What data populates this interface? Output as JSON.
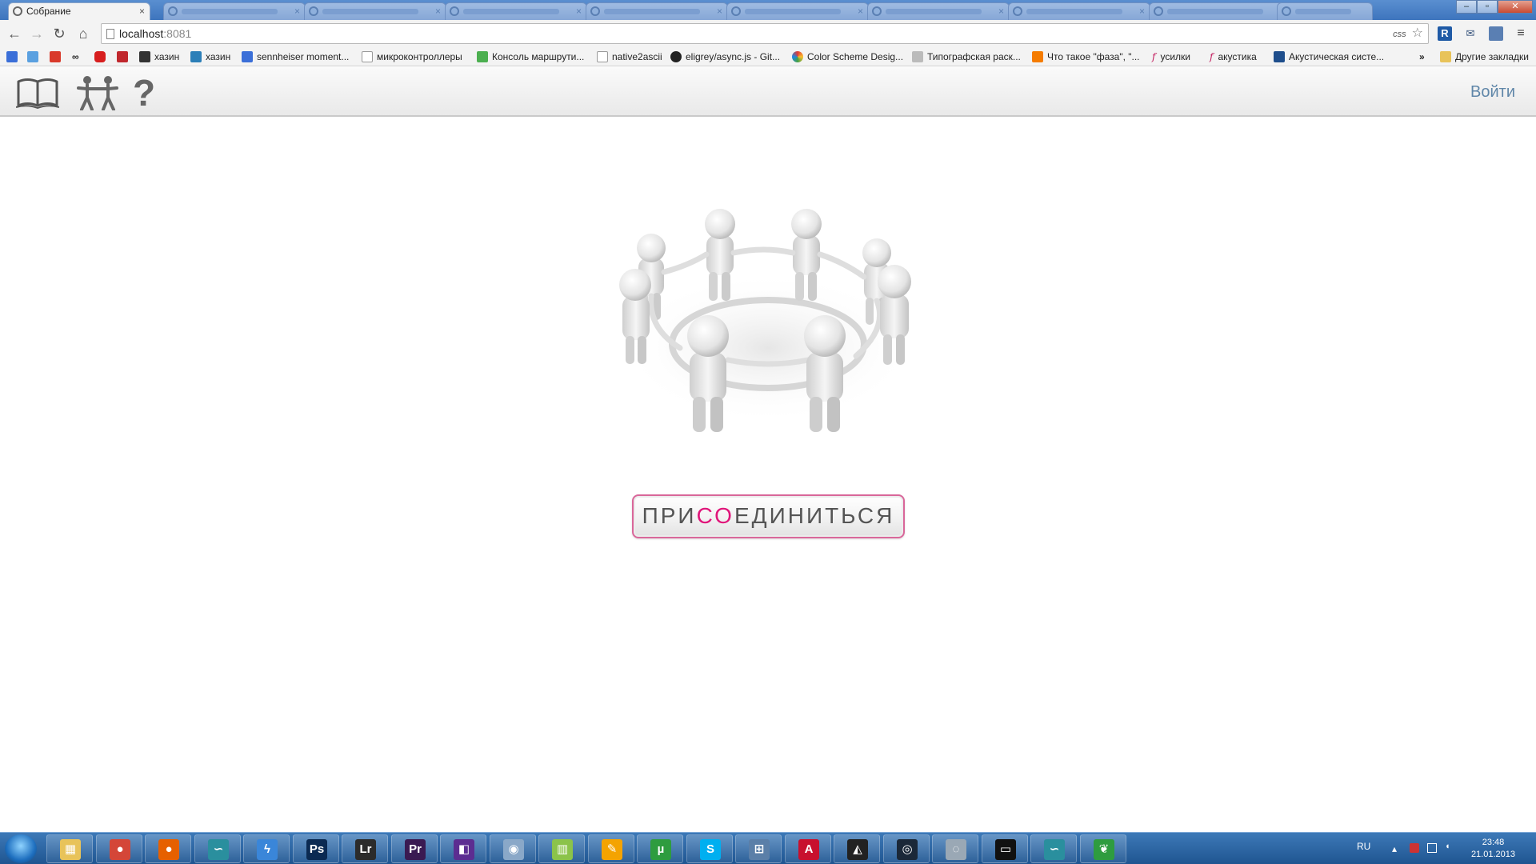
{
  "browser": {
    "active_tab_title": "Собрание",
    "tab_close": "×",
    "url_host": "localhost",
    "url_port": ":8081",
    "omnibox_badge": "css",
    "window_buttons": {
      "minimize": "–",
      "maximize": "▫",
      "close": "✕"
    },
    "nav": {
      "back": "←",
      "forward": "→",
      "reload": "↻",
      "home": "⌂"
    },
    "bookmarks": [
      {
        "label": "",
        "icon": "google-plus-icon",
        "color": "#3b6fd8"
      },
      {
        "label": "",
        "icon": "h-icon",
        "color": "#5aa0e0"
      },
      {
        "label": "",
        "icon": "pp-icon",
        "color": "#d93a2b"
      },
      {
        "label": "",
        "icon": "infinity-icon",
        "color": "#222222"
      },
      {
        "label": "",
        "icon": "youtube-icon",
        "color": "#d71e1e"
      },
      {
        "label": "",
        "icon": "red-book-icon",
        "color": "#c0272d"
      },
      {
        "label": "хазин",
        "icon": "rss-icon",
        "color": "#333333"
      },
      {
        "label": "хазин",
        "icon": "chart-icon",
        "color": "#2c7fb8"
      },
      {
        "label": "sennheiser moment...",
        "icon": "google-icon",
        "color": "#3b6fd8"
      },
      {
        "label": "микроконтроллеры",
        "icon": "page-icon",
        "color": "#ffffff"
      },
      {
        "label": "Консоль маршрути...",
        "icon": "grid-icon",
        "color": "#4caf50"
      },
      {
        "label": "native2ascii",
        "icon": "page-icon",
        "color": "#ffffff"
      },
      {
        "label": "eligrey/async.js - Git...",
        "icon": "github-icon",
        "color": "#222222"
      },
      {
        "label": "Color Scheme Desig...",
        "icon": "color-wheel-icon",
        "color": "#e53935"
      },
      {
        "label": "Типографская раск...",
        "icon": "typo-icon",
        "color": "#bbbbbb"
      },
      {
        "label": "Что такое \"фаза\", \"...",
        "icon": "blogger-icon",
        "color": "#f57c00"
      },
      {
        "label": "усилки",
        "icon": "f-script-icon",
        "color": "#c2185b"
      },
      {
        "label": "акустика",
        "icon": "f-script-icon",
        "color": "#c2185b"
      },
      {
        "label": "Акустическая систе...",
        "icon": "blue-square-icon",
        "color": "#1e4e8c"
      }
    ],
    "bookmarks_overflow": "»",
    "other_bookmarks": "Другие закладки"
  },
  "app": {
    "header_icons": [
      "book-icon",
      "people-icon",
      "help-icon"
    ],
    "help_glyph": "?",
    "login_label": "Войти",
    "join_button": {
      "part1": "ПРИ",
      "highlight": "СО",
      "part2": "ЕДИНИТЬСЯ"
    },
    "accent_color": "#e0157a"
  },
  "taskbar": {
    "apps": [
      {
        "name": "explorer",
        "glyph": "▦",
        "color": "#e8c35a"
      },
      {
        "name": "chrome",
        "glyph": "●",
        "color": "#d44638"
      },
      {
        "name": "firefox",
        "glyph": "●",
        "color": "#e66000"
      },
      {
        "name": "dolphin",
        "glyph": "∽",
        "color": "#2a8f9e"
      },
      {
        "name": "thunder",
        "glyph": "ϟ",
        "color": "#3a86d9"
      },
      {
        "name": "photoshop",
        "glyph": "Ps",
        "color": "#0b2a52"
      },
      {
        "name": "lightroom",
        "glyph": "Lr",
        "color": "#2b2b2b"
      },
      {
        "name": "premiere",
        "glyph": "Pr",
        "color": "#3a1a52"
      },
      {
        "name": "visual-studio",
        "glyph": "◧",
        "color": "#5c2d91"
      },
      {
        "name": "disk",
        "glyph": "◉",
        "color": "#8aa8c8"
      },
      {
        "name": "chart-tool",
        "glyph": "▥",
        "color": "#8bc34a"
      },
      {
        "name": "paint",
        "glyph": "✎",
        "color": "#f4a300"
      },
      {
        "name": "utorrent",
        "glyph": "µ",
        "color": "#2e9c3f"
      },
      {
        "name": "skype",
        "glyph": "S",
        "color": "#00aff0"
      },
      {
        "name": "network",
        "glyph": "⊞",
        "color": "#5b7fa8"
      },
      {
        "name": "acrobat",
        "glyph": "A",
        "color": "#c8102e"
      },
      {
        "name": "alien",
        "glyph": "◭",
        "color": "#222222"
      },
      {
        "name": "steam",
        "glyph": "◎",
        "color": "#1b2838"
      },
      {
        "name": "media",
        "glyph": "◌",
        "color": "#9aa8b5"
      },
      {
        "name": "terminal",
        "glyph": "▭",
        "color": "#111111"
      },
      {
        "name": "dolphin-2",
        "glyph": "∽",
        "color": "#2a8f9e"
      },
      {
        "name": "leaf",
        "glyph": "❦",
        "color": "#2e9c3f"
      }
    ],
    "language": "RU",
    "time": "23:48",
    "date": "21.01.2013"
  }
}
